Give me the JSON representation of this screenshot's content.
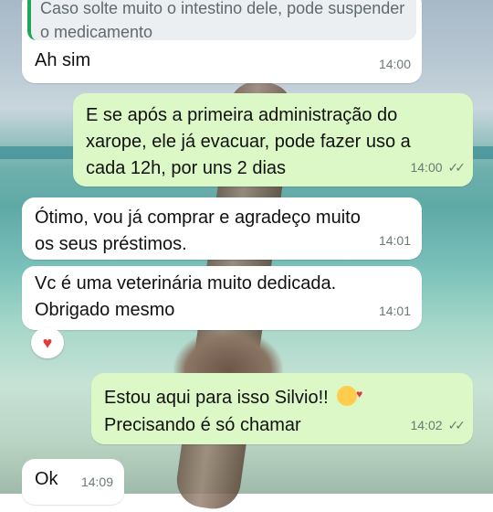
{
  "chat": {
    "quoted_reply": "Caso solte muito o intestino dele, pode suspender o medicamento",
    "messages": [
      {
        "dir": "in",
        "text": "Ah sim",
        "time": "14:00"
      },
      {
        "dir": "out",
        "text": "E se após a primeira administração do xarope, ele já evacuar, pode fazer uso a cada 12h, por uns 2 dias",
        "time": "14:00",
        "status": "read"
      },
      {
        "dir": "in",
        "text": "Ótimo, vou já comprar e agradeço muito os seus préstimos.",
        "time": "14:01"
      },
      {
        "dir": "in",
        "text": "Vc é uma veterinária muito dedicada. Obrigado mesmo",
        "time": "14:01",
        "reaction": "red-heart"
      },
      {
        "dir": "out",
        "text": "Estou aqui para isso Silvio!!",
        "text2": "Precisando é só chamar",
        "emoji": "smiling-face-with-hearts",
        "time": "14:02",
        "status": "read"
      },
      {
        "dir": "in",
        "text": "Ok",
        "time": "14:09"
      }
    ]
  },
  "icons": {
    "read_ticks": "double-check-icon",
    "reaction": "heart-icon"
  },
  "colors": {
    "incoming": "#ffffff",
    "outgoing": "#dcf8c6",
    "quote_bar": "#20a654"
  }
}
